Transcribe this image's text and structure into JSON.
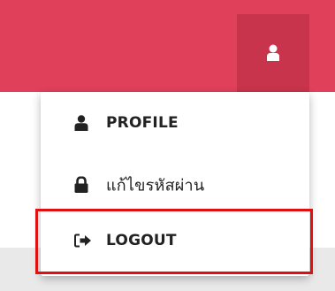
{
  "header": {
    "user_icon": "user-icon",
    "accent_color": "#e0405a"
  },
  "dropdown": {
    "items": [
      {
        "label": "PROFILE",
        "icon": "user-icon"
      },
      {
        "label": "แก้ไขรหัสผ่าน",
        "icon": "lock-icon"
      },
      {
        "label": "LOGOUT",
        "icon": "sign-out-icon",
        "highlighted": true
      }
    ],
    "highlight_color": "#e01010"
  }
}
